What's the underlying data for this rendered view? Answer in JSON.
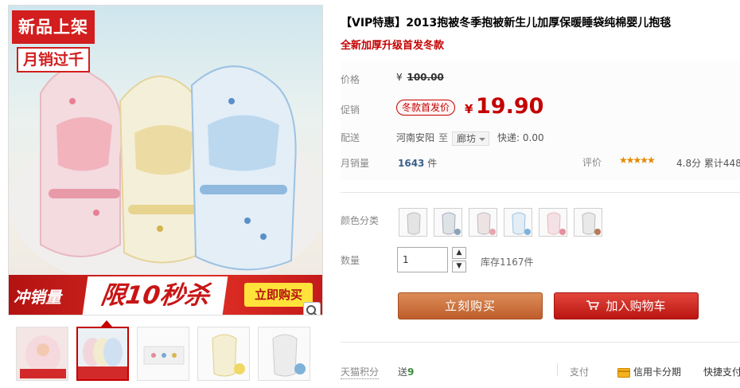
{
  "product": {
    "title": "【VIP特惠】2013抱被冬季抱被新生儿加厚保暖睡袋纯棉婴儿抱毯",
    "subtitle": "全新加厚升级首发冬款"
  },
  "gallery": {
    "badge_line1": "新品上架",
    "badge_line2": "月销过千",
    "promo_text1": "冲销量",
    "promo_text2": "限10秒杀",
    "promo_button": "立即购买"
  },
  "price": {
    "label": "价格",
    "currency": "¥",
    "original": "100.00",
    "promo_label": "促销",
    "promo_tag": "冬款首发价",
    "promo_currency": "¥",
    "promo_price": "19.90"
  },
  "shipping": {
    "label": "配送",
    "from": "河南安阳",
    "to_word": "至",
    "city": "廊坊",
    "fee": "快递: 0.00"
  },
  "sales": {
    "label": "月销量",
    "count": "1643",
    "unit": "件",
    "rating_label": "评价",
    "stars": "★★★★★",
    "score": "4.8分",
    "cumulative": "累计448"
  },
  "options": {
    "color_label": "颜色分类",
    "swatch_colors": [
      "#d8d8d8",
      "#cfd6da",
      "#e8c7c9",
      "#bcd7ea",
      "#eab5bf",
      "#d2d2d2"
    ],
    "qty_label": "数量",
    "qty_value": "1",
    "stock": "库存1167件"
  },
  "actions": {
    "buy_now": "立刻购买",
    "add_to_cart": "加入购物车"
  },
  "footer": {
    "points_label": "天猫积分",
    "points_send": "送",
    "points_value": "9",
    "pay_label": "支付",
    "credit": "信用卡分期",
    "quick_pay": "快捷支付"
  },
  "colors": {
    "accent_red": "#c40000",
    "buy_orange": "#c96a36"
  }
}
